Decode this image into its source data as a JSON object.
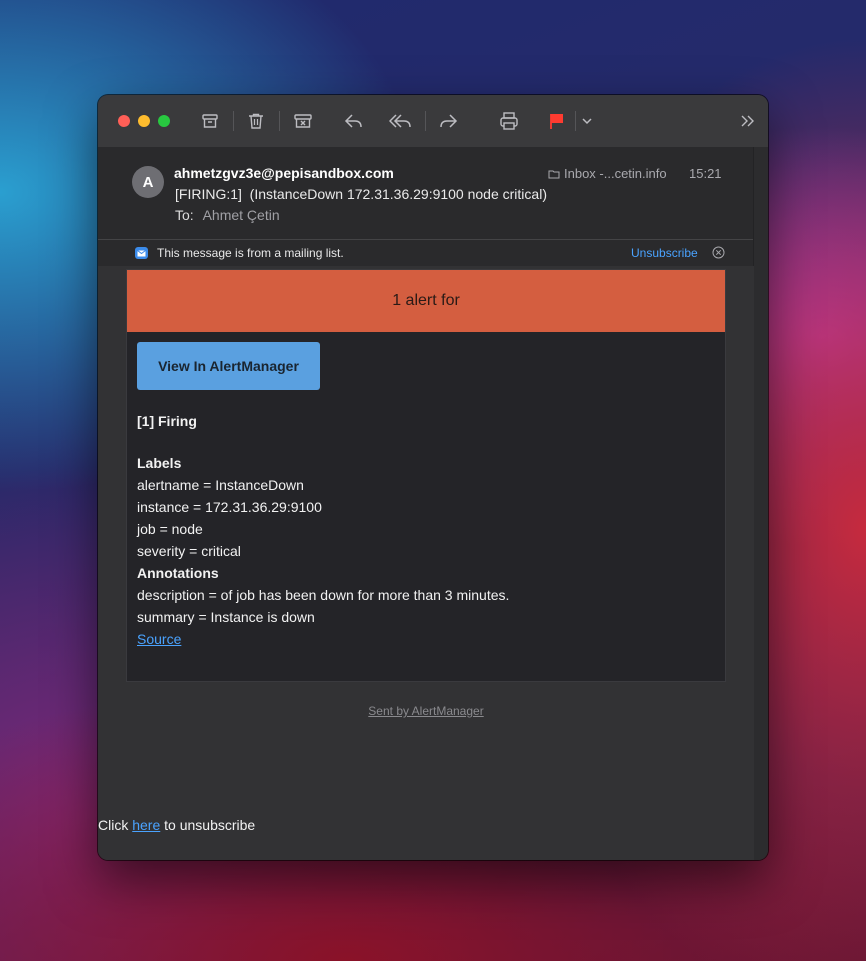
{
  "window": {
    "toolbar": {
      "buttons": [
        "archive-icon",
        "trash-icon",
        "junk-icon",
        "reply-icon",
        "reply-all-icon",
        "forward-icon",
        "print-icon",
        "flag-icon",
        "chevron-down-icon",
        "more-chevrons-icon"
      ],
      "flag_color": "#ff3b30"
    }
  },
  "email": {
    "avatar_initial": "A",
    "from": "ahmetzgvz3e@pepisandbox.com",
    "subject": "[FIRING:1]  (InstanceDown 172.31.36.29:9100 node critical)",
    "to_label": "To:",
    "to_name": "Ahmet Çetin",
    "mailbox": "Inbox -...cetin.info",
    "time": "15:21"
  },
  "mailing_list": {
    "text": "This message is from a mailing list.",
    "unsubscribe": "Unsubscribe"
  },
  "alert": {
    "banner": "1 alert for",
    "banner_color": "#d45e40",
    "button": "View In AlertManager",
    "firing_title": "[1] Firing",
    "labels_title": "Labels",
    "labels": [
      "alertname = InstanceDown",
      "instance = 172.31.36.29:9100",
      "job = node",
      "severity = critical"
    ],
    "annotations_title": "Annotations",
    "annotations": [
      "description = of job has been down for more than 3 minutes.",
      "summary = Instance is down"
    ],
    "source_link": "Source"
  },
  "footer": {
    "sent_by": "Sent by AlertManager",
    "click": "Click",
    "here": "here",
    "to_unsubscribe": "to unsubscribe"
  }
}
